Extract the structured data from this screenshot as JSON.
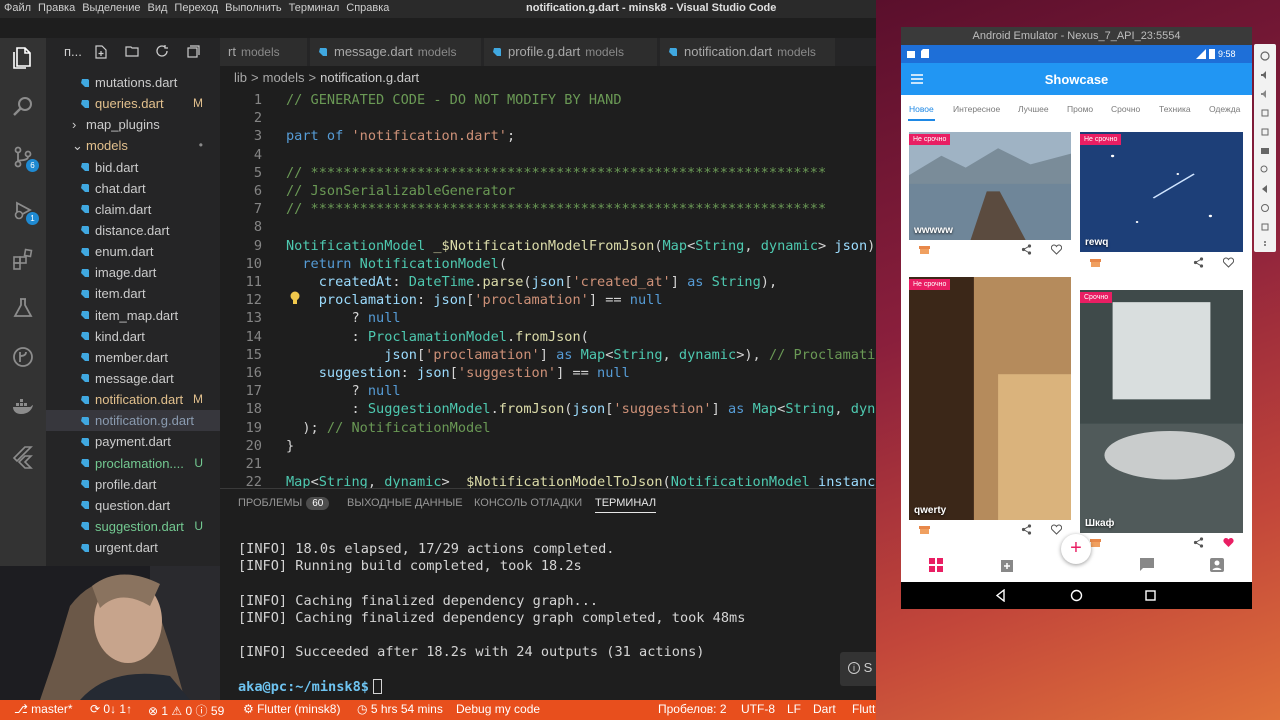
{
  "vscode": {
    "menu": [
      "Файл",
      "Правка",
      "Выделение",
      "Вид",
      "Переход",
      "Выполнить",
      "Терминал",
      "Справка"
    ],
    "window_title": "notification.g.dart - minsk8 - Visual Studio Code",
    "activity_badges": {
      "scm": "6",
      "debug": "1"
    },
    "side_toolbar_label": "п...",
    "explorer": [
      {
        "label": "mutations.dart",
        "status": "",
        "color": "#cccccc"
      },
      {
        "label": "queries.dart",
        "status": "M",
        "color": "#e2c08d"
      },
      {
        "label": "map_plugins",
        "status": "",
        "color": "#cccccc"
      },
      {
        "label": "models",
        "status": "•",
        "color": "#e2c08d"
      },
      {
        "label": "bid.dart",
        "status": "",
        "color": "#cccccc"
      },
      {
        "label": "chat.dart",
        "status": "",
        "color": "#cccccc"
      },
      {
        "label": "claim.dart",
        "status": "",
        "color": "#cccccc"
      },
      {
        "label": "distance.dart",
        "status": "",
        "color": "#cccccc"
      },
      {
        "label": "enum.dart",
        "status": "",
        "color": "#cccccc"
      },
      {
        "label": "image.dart",
        "status": "",
        "color": "#cccccc"
      },
      {
        "label": "item.dart",
        "status": "",
        "color": "#cccccc"
      },
      {
        "label": "item_map.dart",
        "status": "",
        "color": "#cccccc"
      },
      {
        "label": "kind.dart",
        "status": "",
        "color": "#cccccc"
      },
      {
        "label": "member.dart",
        "status": "",
        "color": "#cccccc"
      },
      {
        "label": "message.dart",
        "status": "",
        "color": "#cccccc"
      },
      {
        "label": "notification.dart",
        "status": "M",
        "color": "#e2c08d"
      },
      {
        "label": "notification.g.dart",
        "status": "",
        "color": "#8a9bb0"
      },
      {
        "label": "payment.dart",
        "status": "",
        "color": "#cccccc"
      },
      {
        "label": "proclamation....",
        "status": "U",
        "color": "#73c991"
      },
      {
        "label": "profile.dart",
        "status": "",
        "color": "#cccccc"
      },
      {
        "label": "question.dart",
        "status": "",
        "color": "#cccccc"
      },
      {
        "label": "suggestion.dart",
        "status": "U",
        "color": "#73c991"
      },
      {
        "label": "urgent.dart",
        "status": "",
        "color": "#cccccc"
      }
    ],
    "tabs": [
      {
        "name": "rt",
        "dir": "models"
      },
      {
        "name": "message.dart",
        "dir": "models"
      },
      {
        "name": "profile.g.dart",
        "dir": "models"
      },
      {
        "name": "notification.dart",
        "dir": "models"
      }
    ],
    "breadcrumb": [
      "lib",
      ">",
      "models",
      ">",
      "notification.g.dart"
    ],
    "editor": {
      "lines": [
        {
          "n": "1",
          "parts": [
            [
              "c-comment",
              "// GENERATED CODE - DO NOT MODIFY BY HAND"
            ]
          ]
        },
        {
          "n": "2",
          "parts": []
        },
        {
          "n": "3",
          "parts": [
            [
              "c-kw",
              "part of "
            ],
            [
              "c-str",
              "'notification.dart'"
            ],
            [
              "c-txt",
              ";"
            ]
          ]
        },
        {
          "n": "4",
          "parts": []
        },
        {
          "n": "5",
          "parts": [
            [
              "c-comment",
              "// ***************************************************************"
            ]
          ]
        },
        {
          "n": "6",
          "parts": [
            [
              "c-comment",
              "// JsonSerializableGenerator"
            ]
          ]
        },
        {
          "n": "7",
          "parts": [
            [
              "c-comment",
              "// ***************************************************************"
            ]
          ]
        },
        {
          "n": "8",
          "parts": []
        },
        {
          "n": "9",
          "parts": [
            [
              "c-type",
              "NotificationModel "
            ],
            [
              "c-fn",
              "_$NotificationModelFromJson"
            ],
            [
              "c-txt",
              "("
            ],
            [
              "c-type",
              "Map"
            ],
            [
              "c-txt",
              "<"
            ],
            [
              "c-type",
              "String"
            ],
            [
              "c-txt",
              ", "
            ],
            [
              "c-type",
              "dynamic"
            ],
            [
              "c-txt",
              "> "
            ],
            [
              "c-var",
              "json"
            ],
            [
              "c-txt",
              ")"
            ]
          ]
        },
        {
          "n": "10",
          "parts": [
            [
              "c-kw",
              "  return "
            ],
            [
              "c-type",
              "NotificationModel"
            ],
            [
              "c-txt",
              "("
            ]
          ]
        },
        {
          "n": "11",
          "parts": [
            [
              "c-var",
              "    createdAt"
            ],
            [
              "c-txt",
              ": "
            ],
            [
              "c-type",
              "DateTime"
            ],
            [
              "c-txt",
              "."
            ],
            [
              "c-fn",
              "parse"
            ],
            [
              "c-txt",
              "("
            ],
            [
              "c-var",
              "json"
            ],
            [
              "c-txt",
              "["
            ],
            [
              "c-str",
              "'created_at'"
            ],
            [
              "c-txt",
              "] "
            ],
            [
              "c-kw",
              "as "
            ],
            [
              "c-type",
              "String"
            ],
            [
              "c-txt",
              "),"
            ]
          ]
        },
        {
          "n": "12",
          "parts": [
            [
              "c-var",
              "    proclamation"
            ],
            [
              "c-txt",
              ": "
            ],
            [
              "c-var",
              "json"
            ],
            [
              "c-txt",
              "["
            ],
            [
              "c-str",
              "'proclamation'"
            ],
            [
              "c-txt",
              "] == "
            ],
            [
              "c-kw",
              "null"
            ]
          ]
        },
        {
          "n": "13",
          "parts": [
            [
              "c-txt",
              "        ? "
            ],
            [
              "c-kw",
              "null"
            ]
          ]
        },
        {
          "n": "14",
          "parts": [
            [
              "c-txt",
              "        : "
            ],
            [
              "c-type",
              "ProclamationModel"
            ],
            [
              "c-txt",
              "."
            ],
            [
              "c-fn",
              "fromJson"
            ],
            [
              "c-txt",
              "("
            ]
          ]
        },
        {
          "n": "15",
          "parts": [
            [
              "c-var",
              "            json"
            ],
            [
              "c-txt",
              "["
            ],
            [
              "c-str",
              "'proclamation'"
            ],
            [
              "c-txt",
              "] "
            ],
            [
              "c-kw",
              "as "
            ],
            [
              "c-type",
              "Map"
            ],
            [
              "c-txt",
              "<"
            ],
            [
              "c-type",
              "String"
            ],
            [
              "c-txt",
              ", "
            ],
            [
              "c-type",
              "dynamic"
            ],
            [
              "c-txt",
              ">), "
            ],
            [
              "c-comment",
              "// ProclamationModel"
            ]
          ]
        },
        {
          "n": "16",
          "parts": [
            [
              "c-var",
              "    suggestion"
            ],
            [
              "c-txt",
              ": "
            ],
            [
              "c-var",
              "json"
            ],
            [
              "c-txt",
              "["
            ],
            [
              "c-str",
              "'suggestion'"
            ],
            [
              "c-txt",
              "] == "
            ],
            [
              "c-kw",
              "null"
            ]
          ]
        },
        {
          "n": "17",
          "parts": [
            [
              "c-txt",
              "        ? "
            ],
            [
              "c-kw",
              "null"
            ]
          ]
        },
        {
          "n": "18",
          "parts": [
            [
              "c-txt",
              "        : "
            ],
            [
              "c-type",
              "SuggestionModel"
            ],
            [
              "c-txt",
              "."
            ],
            [
              "c-fn",
              "fromJson"
            ],
            [
              "c-txt",
              "("
            ],
            [
              "c-var",
              "json"
            ],
            [
              "c-txt",
              "["
            ],
            [
              "c-str",
              "'suggestion'"
            ],
            [
              "c-txt",
              "] "
            ],
            [
              "c-kw",
              "as "
            ],
            [
              "c-type",
              "Map"
            ],
            [
              "c-txt",
              "<"
            ],
            [
              "c-type",
              "String"
            ],
            [
              "c-txt",
              ", "
            ],
            [
              "c-type",
              "dynamic"
            ],
            [
              "c-txt",
              ">),"
            ]
          ]
        },
        {
          "n": "19",
          "parts": [
            [
              "c-txt",
              "  ); "
            ],
            [
              "c-comment",
              "// NotificationModel"
            ]
          ]
        },
        {
          "n": "20",
          "parts": [
            [
              "c-txt",
              "}"
            ]
          ]
        },
        {
          "n": "21",
          "parts": []
        },
        {
          "n": "22",
          "parts": [
            [
              "c-type",
              "Map"
            ],
            [
              "c-txt",
              "<"
            ],
            [
              "c-type",
              "String"
            ],
            [
              "c-txt",
              ", "
            ],
            [
              "c-type",
              "dynamic"
            ],
            [
              "c-txt",
              "> "
            ],
            [
              "c-fn",
              "_$NotificationModelToJson"
            ],
            [
              "c-txt",
              "("
            ],
            [
              "c-type",
              "NotificationModel"
            ],
            [
              "c-var",
              " instance"
            ],
            [
              "c-txt",
              ")"
            ]
          ]
        }
      ]
    },
    "panel": {
      "tabs": [
        {
          "label": "ПРОБЛЕМЫ",
          "badge": "60"
        },
        {
          "label": "ВЫХОДНЫЕ ДАННЫЕ",
          "badge": ""
        },
        {
          "label": "КОНСОЛЬ ОТЛАДКИ",
          "badge": ""
        },
        {
          "label": "ТЕРМИНАЛ",
          "badge": ""
        }
      ],
      "terminal": [
        "[INFO] 18.0s elapsed, 17/29 actions completed.",
        "[INFO] Running build completed, took 18.2s",
        "",
        "[INFO] Caching finalized dependency graph...",
        "[INFO] Caching finalized dependency graph completed, took 48ms",
        "",
        "[INFO] Succeeded after 18.2s with 24 outputs (31 actions)",
        "",
        "aka@pc:~/minsk8$"
      ],
      "prompt_user": "aka@pc:~/minsk8$",
      "chip": "S"
    },
    "statusbar": {
      "branch": "master*",
      "sync": "0↓ 1↑",
      "errors": "1",
      "warnings": "0",
      "info": "59",
      "flutter": "Flutter (minsk8)",
      "time": "5 hrs 54 mins",
      "debug": "Debug my code",
      "spaces": "Пробелов: 2",
      "encoding": "UTF-8",
      "eol": "LF",
      "language": "Dart",
      "extra": "Flutt"
    }
  },
  "emulator": {
    "title": "Android Emulator - Nexus_7_API_23:5554",
    "time": "9:58",
    "app_title": "Showcase",
    "tabs": [
      "Новое",
      "Интересное",
      "Лучшее",
      "Промо",
      "Срочно",
      "Техника",
      "Одежда"
    ],
    "cards": [
      {
        "badge": "Не срочно",
        "title": "wwwww",
        "liked": false
      },
      {
        "badge": "Не срочно",
        "title": "rewq",
        "liked": false
      },
      {
        "badge": "Не срочно",
        "title": "qwerty",
        "liked": false
      },
      {
        "badge": "Срочно",
        "title": "Шкаф",
        "liked": true
      }
    ],
    "colors": {
      "primary": "#2196f3",
      "accent": "#e91e63",
      "active_tab": "#1e88e5"
    },
    "fab_symbol": "+"
  },
  "desktop": {
    "accent": "#e84f1d"
  }
}
